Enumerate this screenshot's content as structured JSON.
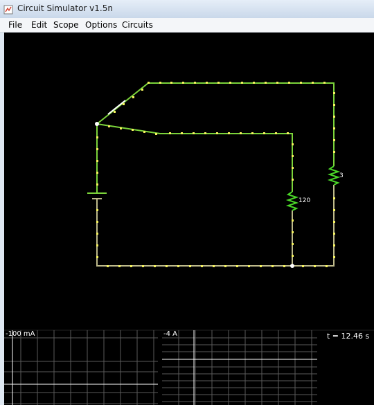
{
  "window": {
    "title": "Circuit Simulator v1.5n"
  },
  "menu": [
    "File",
    "Edit",
    "Scope",
    "Options",
    "Circuits"
  ],
  "circuit": {
    "resistor_left_label": "120",
    "resistor_right_label": "3"
  },
  "scopes": [
    {
      "label": "-100 mA"
    },
    {
      "label": "-4 A"
    }
  ],
  "time_readout": "t = 12.46 s",
  "colors": {
    "canvas_bg": "#000000",
    "wire_active": "#7bd33a",
    "wire_low": "#bdb98a",
    "current_dot": "#f4f25e",
    "scope_grid": "#5a5a5a",
    "scope_trace": "#ffffff"
  },
  "icons": {
    "app": "circuit-app-icon"
  }
}
